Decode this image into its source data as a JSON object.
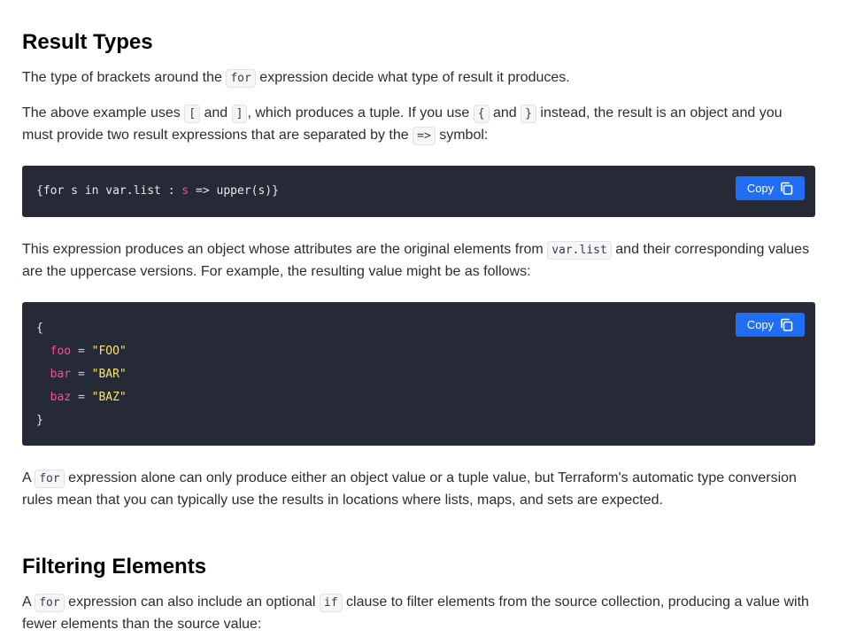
{
  "section1": {
    "heading": "Result Types",
    "para1": {
      "before": "The type of brackets around the ",
      "code": "for",
      "after": " expression decide what type of result it produces."
    },
    "para2": {
      "t1": "The above example uses ",
      "c1": "[",
      "t2": " and ",
      "c2": "]",
      "t3": ", which produces a tuple. If you use ",
      "c3": "{",
      "t4": " and ",
      "c4": "}",
      "t5": " instead, the result is an object and you must provide two result expressions that are separated by the ",
      "c5": "=>",
      "t6": " symbol:"
    },
    "code1": {
      "prefix": "{for s in var.list : ",
      "var": "s",
      "suffix": " => upper(s)}",
      "copy_label": "Copy"
    },
    "para3": {
      "t1": "This expression produces an object whose attributes are the original elements from ",
      "c1": "var.list",
      "t2": " and their corresponding values are the uppercase versions. For example, the resulting value might be as follows:"
    },
    "code2": {
      "open": "{",
      "close": "}",
      "rows": [
        {
          "key": "foo",
          "op": "=",
          "value": "\"FOO\""
        },
        {
          "key": "bar",
          "op": "=",
          "value": "\"BAR\""
        },
        {
          "key": "baz",
          "op": "=",
          "value": "\"BAZ\""
        }
      ],
      "copy_label": "Copy"
    },
    "para4": {
      "t1": "A ",
      "c1": "for",
      "t2": " expression alone can only produce either an object value or a tuple value, but Terraform's automatic type conversion rules mean that you can typically use the results in locations where lists, maps, and sets are expected."
    }
  },
  "section2": {
    "heading": "Filtering Elements",
    "para1": {
      "t1": "A ",
      "c1": "for",
      "t2": " expression can also include an optional ",
      "c2": "if",
      "t3": " clause to filter elements from the source collection, producing a value with fewer elements than the source value:"
    }
  },
  "colors": {
    "code_bg": "#262a36",
    "copy_button": "#1f6ef5",
    "token_attr": "#f4518f",
    "token_string": "#f9e26b"
  },
  "icons": {
    "copy": "copy-icon"
  }
}
